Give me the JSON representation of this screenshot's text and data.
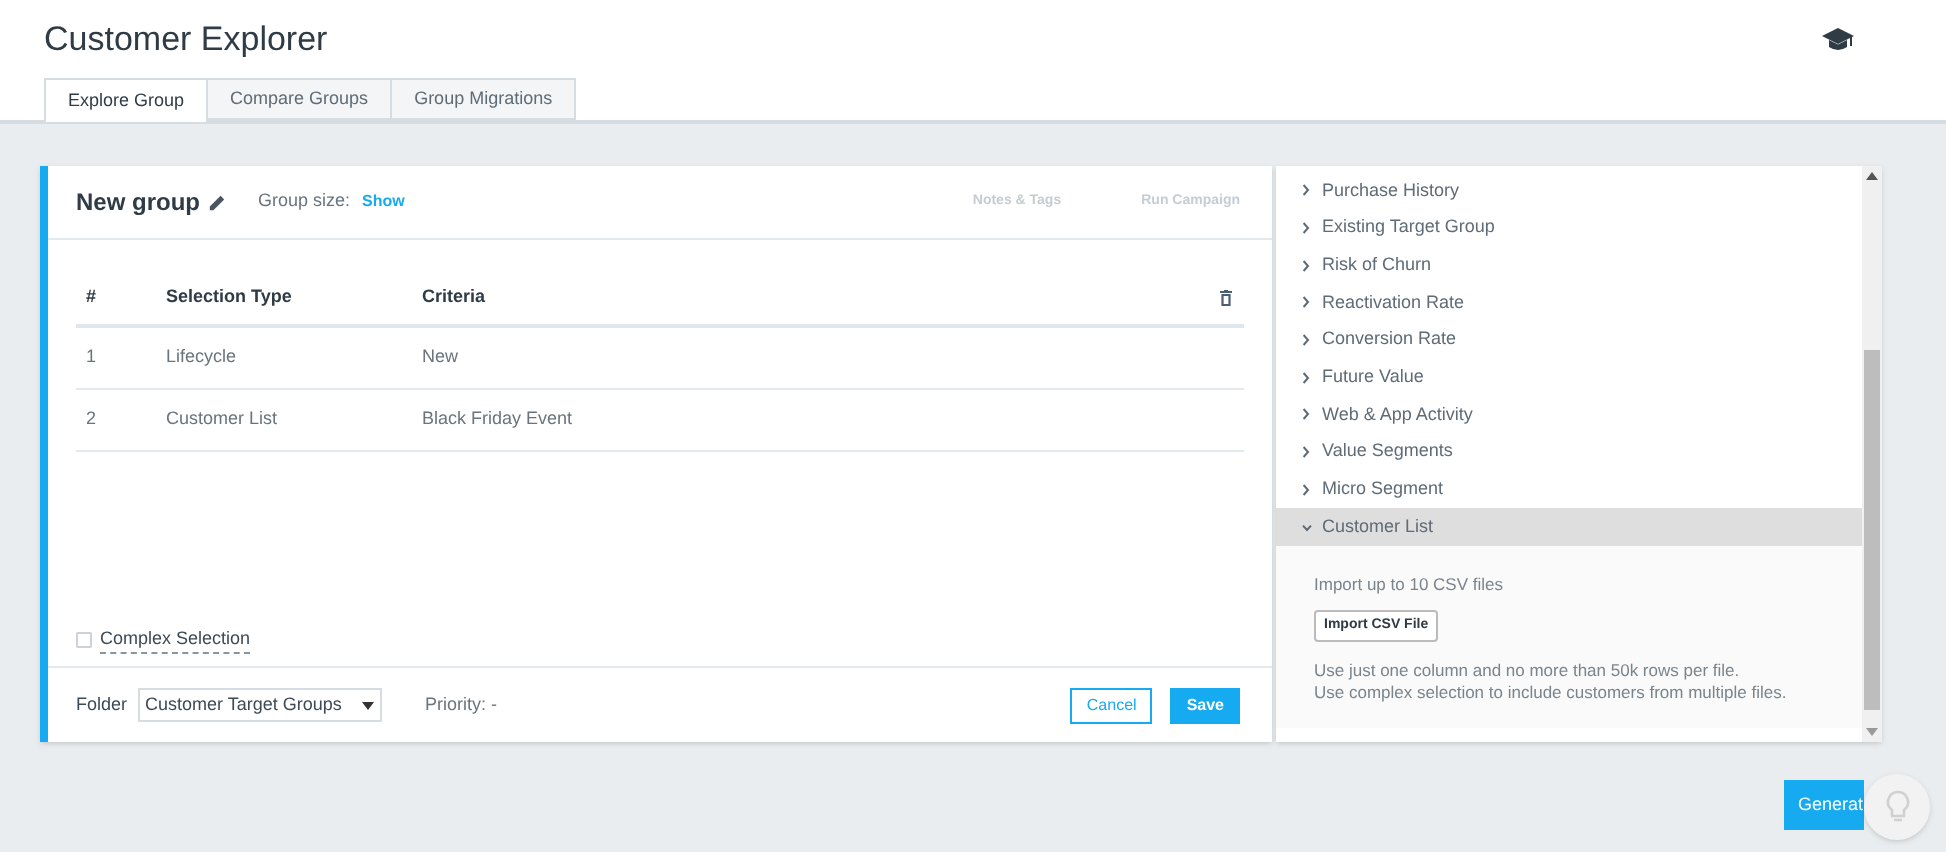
{
  "header": {
    "title": "Customer Explorer"
  },
  "tabs": [
    {
      "label": "Explore Group",
      "selected": true
    },
    {
      "label": "Compare Groups",
      "selected": false
    },
    {
      "label": "Group Migrations",
      "selected": false
    }
  ],
  "group": {
    "name": "New group",
    "size_label": "Group size:",
    "size_link": "Show",
    "actions": [
      {
        "label": "Notes & Tags",
        "disabled": true
      },
      {
        "label": "Run Campaign",
        "disabled": true
      }
    ],
    "table": {
      "columns": [
        "#",
        "Selection Type",
        "Criteria"
      ],
      "rows": [
        [
          "1",
          "Lifecycle",
          "New"
        ],
        [
          "2",
          "Customer List",
          "Black Friday Event"
        ]
      ]
    },
    "complex_selection": {
      "label": "Complex Selection",
      "checked": false
    },
    "folder": {
      "label": "Folder",
      "value": "Customer Target Groups"
    },
    "priority": "Priority: -",
    "buttons": [
      {
        "label": "Cancel",
        "kind": "outline"
      },
      {
        "label": "Save",
        "kind": "primary"
      }
    ]
  },
  "criteria_panel": {
    "items": [
      {
        "label": "Purchase History",
        "expanded": false
      },
      {
        "label": "Existing Target Group",
        "expanded": false
      },
      {
        "label": "Risk of Churn",
        "expanded": false
      },
      {
        "label": "Reactivation Rate",
        "expanded": false
      },
      {
        "label": "Conversion Rate",
        "expanded": false
      },
      {
        "label": "Future Value",
        "expanded": false
      },
      {
        "label": "Web & App Activity",
        "expanded": false
      },
      {
        "label": "Value Segments",
        "expanded": false
      },
      {
        "label": "Micro Segment",
        "expanded": false
      },
      {
        "label": "Customer List",
        "expanded": true,
        "detail": {
          "intro": "Import up to 10 CSV files",
          "button": "Import CSV File",
          "notes": [
            "Use just one column and no more than 50k rows per file.",
            "Use complex selection to include customers from multiple files."
          ]
        }
      }
    ]
  },
  "generate_button": "Generat"
}
